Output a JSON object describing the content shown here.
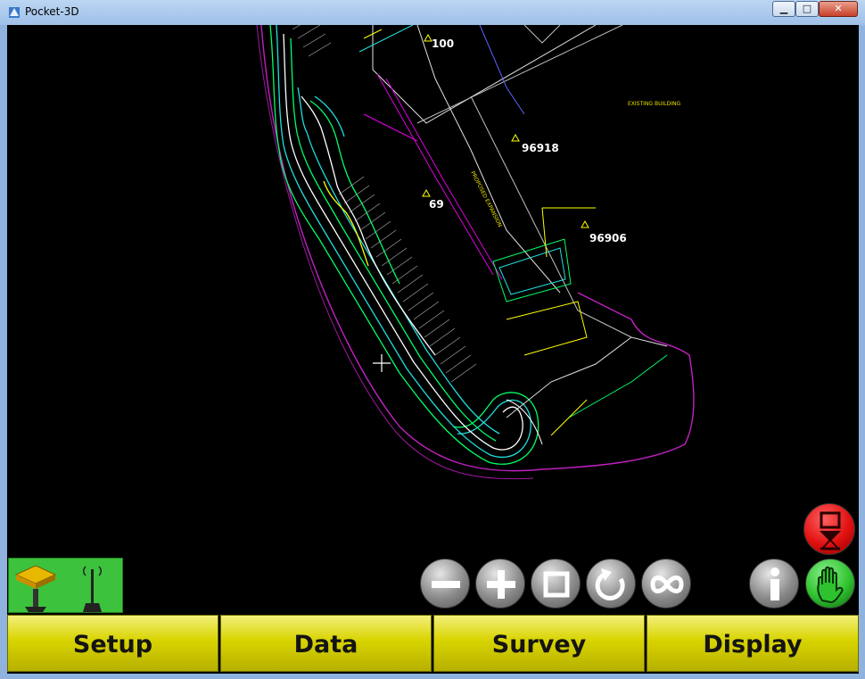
{
  "window": {
    "title": "Pocket-3D",
    "controls": [
      "minimize",
      "maximize",
      "close"
    ]
  },
  "map": {
    "points": [
      {
        "label": "100"
      },
      {
        "label": "96918"
      },
      {
        "label": "69"
      },
      {
        "label": "96906"
      }
    ],
    "annotations": {
      "existing_building": "EXISTING BUILDING",
      "proposed_expansion": "PROPOSED EXPANSION"
    },
    "crosshair": "crosshair"
  },
  "toolbar": {
    "zoom_out": "minus-icon",
    "zoom_in": "plus-icon",
    "zoom_extents": "square-icon",
    "refresh": "rotate-icon",
    "infinity": "infinity-icon",
    "info": "info-icon",
    "pan": "hand-icon",
    "stop": "stop-icon"
  },
  "menu": {
    "setup": "Setup",
    "data": "Data",
    "survey": "Survey",
    "display": "Display"
  },
  "colors": {
    "menu_yellow": "#d8d400",
    "gps_green": "#3cc23c",
    "stop_red": "#e01010",
    "hand_green": "#2fc22f"
  }
}
